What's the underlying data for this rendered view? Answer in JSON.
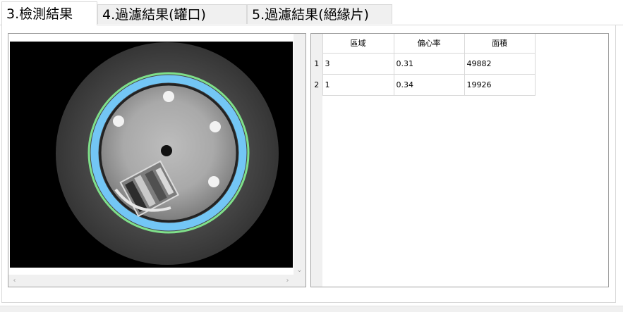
{
  "tabs": [
    {
      "label": "3.檢測結果",
      "active": true
    },
    {
      "label": "4.過濾結果(罐口)",
      "active": false
    },
    {
      "label": "5.過濾結果(絕緣片)",
      "active": false
    }
  ],
  "grid": {
    "columns": [
      "區域",
      "偏心率",
      "面積"
    ],
    "rows": [
      {
        "row_num": "1",
        "cells": [
          "3",
          "0.31",
          "49882"
        ]
      },
      {
        "row_num": "2",
        "cells": [
          "1",
          "0.34",
          "19926"
        ]
      }
    ]
  },
  "colors": {
    "detection_ring_outer": "#7fe08a",
    "detection_ring_inner": "#73c6f5"
  }
}
